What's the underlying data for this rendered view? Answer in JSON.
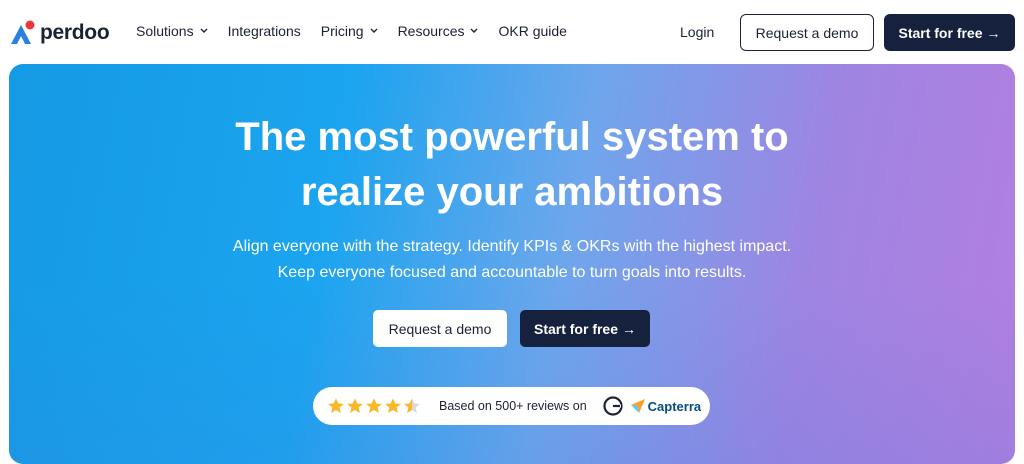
{
  "header": {
    "logo_text": "perdoo",
    "nav": [
      {
        "label": "Solutions",
        "has_dropdown": true
      },
      {
        "label": "Integrations",
        "has_dropdown": false
      },
      {
        "label": "Pricing",
        "has_dropdown": true
      },
      {
        "label": "Resources",
        "has_dropdown": true
      },
      {
        "label": "OKR guide",
        "has_dropdown": false
      }
    ],
    "login_label": "Login",
    "demo_label": "Request a demo",
    "start_label": "Start for free",
    "start_arrow": "→"
  },
  "hero": {
    "headline_line1": "The most powerful system to",
    "headline_line2": "realize your ambitions",
    "sub_line1": "Align everyone with the strategy. Identify KPIs & OKRs with the highest impact.",
    "sub_line2": "Keep everyone focused and accountable to turn goals into results.",
    "demo_label": "Request a demo",
    "start_label": "Start for free",
    "start_arrow": "→"
  },
  "reviews": {
    "rating": 4.5,
    "max_rating": 5,
    "text": "Based on 500+ reviews on",
    "g2_icon": "g2-icon",
    "capterra_label": "Capterra"
  },
  "colors": {
    "brand_dark": "#15213d",
    "gradient_start": "#159ae4",
    "gradient_end": "#b27fdf",
    "star": "#f6b928",
    "capterra": "#044d80"
  }
}
